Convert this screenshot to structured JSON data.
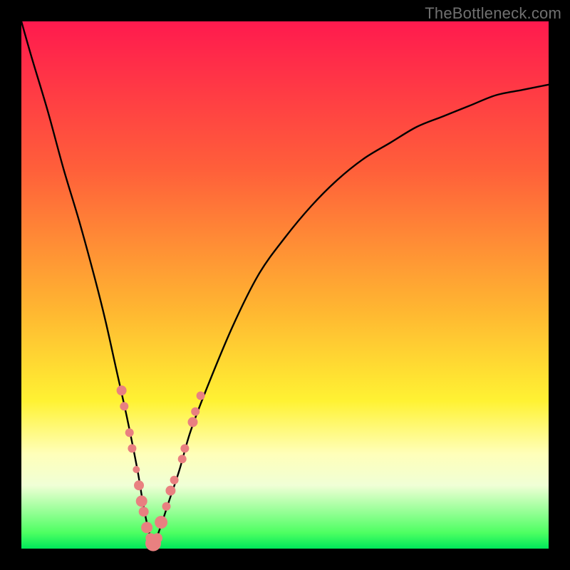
{
  "watermark": "TheBottleneck.com",
  "chart_data": {
    "type": "line",
    "title": "",
    "xlabel": "",
    "ylabel": "",
    "xlim": [
      0,
      100
    ],
    "ylim": [
      0,
      100
    ],
    "background_gradient": {
      "stops": [
        {
          "pct": 0,
          "color": "#ff1a4e"
        },
        {
          "pct": 28,
          "color": "#ff5f3a"
        },
        {
          "pct": 55,
          "color": "#ffb731"
        },
        {
          "pct": 72,
          "color": "#fff233"
        },
        {
          "pct": 82,
          "color": "#ffffb9"
        },
        {
          "pct": 88,
          "color": "#f0ffd6"
        },
        {
          "pct": 97,
          "color": "#4dff62"
        },
        {
          "pct": 100,
          "color": "#00e85a"
        }
      ]
    },
    "series": [
      {
        "name": "bottleneck-curve",
        "x": [
          0,
          2,
          5,
          8,
          11,
          14,
          16,
          18,
          20,
          22,
          23,
          24,
          25,
          26,
          28,
          30,
          32,
          35,
          40,
          45,
          50,
          55,
          60,
          65,
          70,
          75,
          80,
          85,
          90,
          95,
          100
        ],
        "y": [
          100,
          93,
          83,
          72,
          62,
          51,
          43,
          34,
          25,
          15,
          9,
          4,
          1,
          3,
          9,
          15,
          22,
          30,
          42,
          52,
          59,
          65,
          70,
          74,
          77,
          80,
          82,
          84,
          86,
          87,
          88
        ]
      }
    ],
    "markers": {
      "name": "highlighted-points",
      "color": "#e98080",
      "radius_range": [
        5,
        11
      ],
      "points": [
        {
          "x": 19.0,
          "y": 30,
          "r": 7
        },
        {
          "x": 19.5,
          "y": 27,
          "r": 6
        },
        {
          "x": 20.5,
          "y": 22,
          "r": 6
        },
        {
          "x": 21.0,
          "y": 19,
          "r": 6
        },
        {
          "x": 21.8,
          "y": 15,
          "r": 5
        },
        {
          "x": 22.3,
          "y": 12,
          "r": 7
        },
        {
          "x": 22.8,
          "y": 9,
          "r": 8
        },
        {
          "x": 23.2,
          "y": 7,
          "r": 7
        },
        {
          "x": 23.8,
          "y": 4,
          "r": 8
        },
        {
          "x": 24.5,
          "y": 2,
          "r": 7
        },
        {
          "x": 25.0,
          "y": 1,
          "r": 11
        },
        {
          "x": 25.8,
          "y": 2,
          "r": 7
        },
        {
          "x": 26.5,
          "y": 5,
          "r": 9
        },
        {
          "x": 27.5,
          "y": 8,
          "r": 6
        },
        {
          "x": 28.3,
          "y": 11,
          "r": 7
        },
        {
          "x": 29.0,
          "y": 13,
          "r": 6
        },
        {
          "x": 30.5,
          "y": 17,
          "r": 6
        },
        {
          "x": 31.0,
          "y": 19,
          "r": 6
        },
        {
          "x": 32.5,
          "y": 24,
          "r": 7
        },
        {
          "x": 33.0,
          "y": 26,
          "r": 6
        },
        {
          "x": 34.0,
          "y": 29,
          "r": 6
        }
      ]
    }
  }
}
